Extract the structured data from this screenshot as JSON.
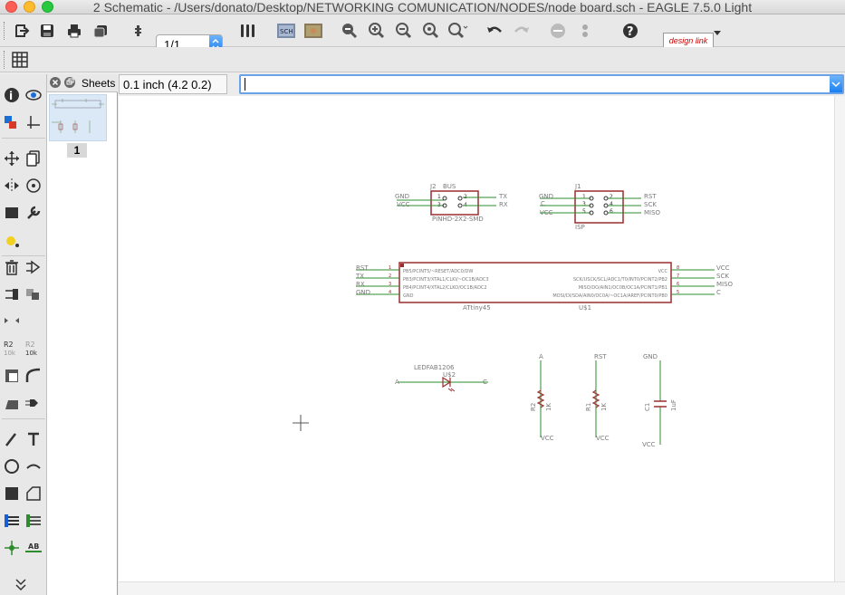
{
  "window": {
    "title": "2 Schematic - /Users/donato/Desktop/NETWORKING COMUNICATION/NODES/node board.sch - EAGLE 7.5.0 Light"
  },
  "toolbar": {
    "sheet_select": "1/1",
    "design_link_label": "design link"
  },
  "sheets_panel": {
    "title": "Sheets",
    "sheet_number": "1"
  },
  "command_bar": {
    "coordinate": "0.1 inch (4.2 0.2)",
    "command_value": ""
  },
  "colors": {
    "component_outline": "#9b2d2d",
    "net_wire": "#2e8b2e",
    "label_text": "#7a7a7a",
    "pin": "#9b2d2d"
  },
  "schematic": {
    "j2": {
      "name": "J2",
      "value": "BUS",
      "package": "PINHD-2X2-SMD",
      "pins": [
        "1",
        "2",
        "3",
        "4"
      ],
      "nets_left": [
        "GND",
        "VCC"
      ],
      "nets_right": [
        "TX",
        "RX"
      ]
    },
    "j1": {
      "name": "J1",
      "value": "ISP",
      "pins": [
        "1",
        "2",
        "3",
        "4",
        "5",
        "6"
      ],
      "nets_left": [
        "GND",
        "C",
        "VCC"
      ],
      "nets_right": [
        "RST",
        "SCK",
        "MISO"
      ]
    },
    "u1": {
      "name": "U$1",
      "value": "ATtiny45",
      "left_pins": [
        {
          "num": "1",
          "label": "PB5/PCINT5/~RESET/ADC0/DW",
          "net": "RST"
        },
        {
          "num": "2",
          "label": "PB3/PCINT3/XTAL1/CLKI/~OC1B/ADC3",
          "net": "TX"
        },
        {
          "num": "3",
          "label": "PB4/PCINT4/XTAL2/CLKO/OC1B/ADC2",
          "net": "RX"
        },
        {
          "num": "4",
          "label": "GND",
          "net": "GND"
        }
      ],
      "right_pins": [
        {
          "num": "8",
          "label": "VCC",
          "net": "VCC"
        },
        {
          "num": "7",
          "label": "SCK/USCK/SCL/ADC1/T0/INT0/PCINT2/PB2",
          "net": "SCK"
        },
        {
          "num": "6",
          "label": "MISO/DO/AIN1/OC0B/OC1A/PCINT1/PB1",
          "net": "MISO"
        },
        {
          "num": "5",
          "label": "MOSI/DI/SDA/AIN0/OC0A/~OC1A/AREF/PCINT0/PB0",
          "net": "C"
        }
      ]
    },
    "led": {
      "name": "U$2",
      "value": "LEDFAB1206",
      "net_left": "A",
      "net_right": "C"
    },
    "r2": {
      "name": "R2",
      "value": "1K",
      "net_top": "A",
      "net_bottom": "VCC"
    },
    "r1": {
      "name": "R1",
      "value": "1K",
      "net_top": "RST",
      "net_bottom": "VCC"
    },
    "c1": {
      "name": "C1",
      "value": "1uF",
      "net_top": "GND",
      "net_bottom": "VCC"
    }
  },
  "icons": {
    "toolbar": [
      "open-icon",
      "save-icon",
      "print-icon",
      "cam-icon",
      "script-icon",
      "ulp-icon",
      "zoom-fit-icon",
      "zoom-in-icon",
      "zoom-out-icon",
      "zoom-redraw-icon",
      "zoom-select-icon",
      "undo-icon",
      "redo-icon",
      "stop-icon",
      "go-icon",
      "help-icon"
    ],
    "left_tools": [
      "info-icon",
      "show-icon",
      "display-icon",
      "mark-icon",
      "move-icon",
      "copy-icon",
      "mirror-icon",
      "rotate-icon",
      "group-icon",
      "change-icon",
      "paste-icon",
      "delete-icon",
      "add-icon",
      "pinswap-icon",
      "replace-icon",
      "gateswap-icon",
      "name-icon",
      "value-icon",
      "smash-icon",
      "miter-icon",
      "split-icon",
      "invoke-icon",
      "wire-icon",
      "text-icon",
      "circle-icon",
      "arc-icon",
      "rect-icon",
      "polygon-icon",
      "bus-icon",
      "net-icon",
      "junction-icon",
      "label-icon",
      "more-icon"
    ]
  }
}
